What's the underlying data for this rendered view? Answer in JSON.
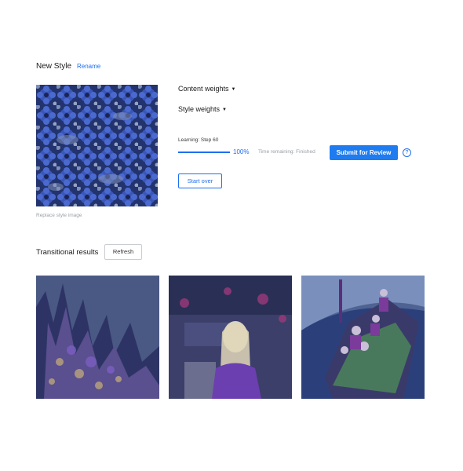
{
  "header": {
    "title": "New Style",
    "rename_label": "Rename"
  },
  "style_image": {
    "replace_label": "Replace style image"
  },
  "controls": {
    "content_weights_label": "Content weights",
    "style_weights_label": "Style weights",
    "learning_status": "Learning: Step 60",
    "progress_percent_label": "100%",
    "progress_fraction": 1.0,
    "time_remaining": "Time remaining: Finished",
    "submit_label": "Submit for Review",
    "help_label": "?",
    "start_over_label": "Start over"
  },
  "transitional": {
    "title": "Transitional results",
    "refresh_label": "Refresh"
  },
  "colors": {
    "accent": "#1e7cf0",
    "tint": "#2b3e8a"
  }
}
